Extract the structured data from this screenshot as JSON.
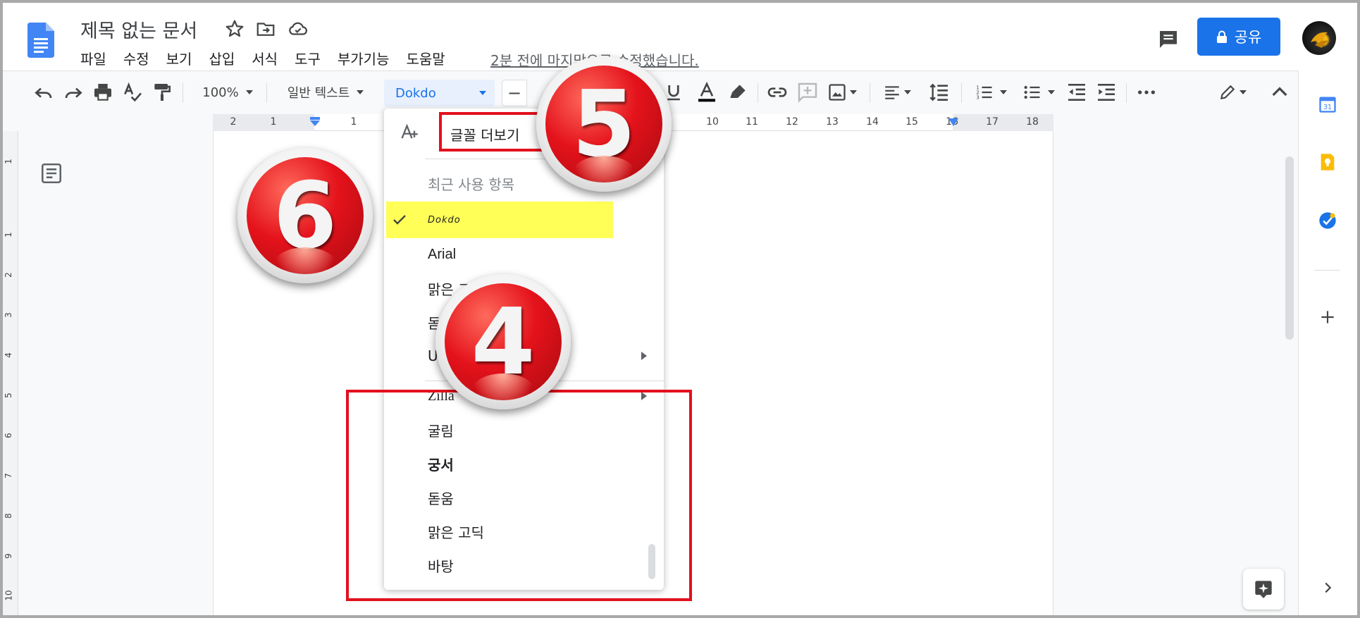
{
  "header": {
    "doc_title": "제목 없는 문서",
    "menu": [
      "파일",
      "수정",
      "보기",
      "삽입",
      "서식",
      "도구",
      "부가기능",
      "도움말"
    ],
    "last_edit": "2분 전에 마지막으로 수정했습니다.",
    "share_label": "공유"
  },
  "toolbar": {
    "zoom": "100%",
    "style": "일반 텍스트",
    "font": "Dokdo",
    "size_minus": "−"
  },
  "ruler": {
    "top_numbers": [
      "2",
      "1",
      "1",
      "10",
      "11",
      "12",
      "13",
      "14",
      "15",
      "16",
      "17",
      "18"
    ],
    "left_numbers": [
      "1",
      "1",
      "2",
      "3",
      "4",
      "5",
      "6",
      "7",
      "8",
      "9",
      "10"
    ]
  },
  "font_menu": {
    "more_fonts": "글꼴 더보기",
    "recent_header": "최근 사용 항목",
    "recent": [
      "Dokdo",
      "Arial",
      "맑은 고",
      "돋",
      "U"
    ],
    "fonts": [
      "Zilla",
      "굴림",
      "궁서",
      "돋움",
      "맑은 고딕",
      "바탕"
    ]
  },
  "side_panel": {
    "calendar_date": "31"
  },
  "annotations": {
    "badge_4": "4",
    "badge_5": "5",
    "badge_6": "6"
  },
  "colors": {
    "accent": "#1a73e8",
    "highlight": "#ffff57",
    "annotation_red": "#e3101d"
  }
}
